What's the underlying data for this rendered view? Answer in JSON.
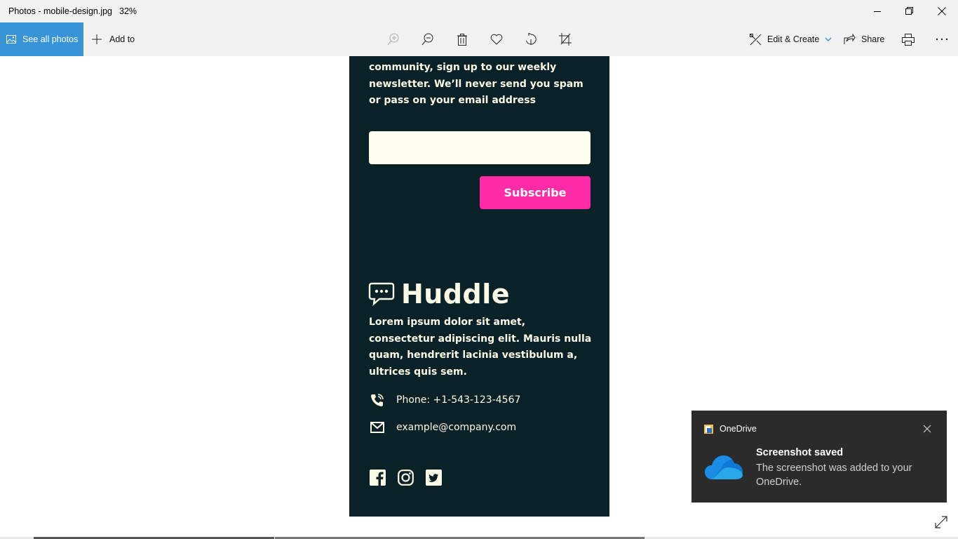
{
  "window": {
    "title": "Photos - mobile-design.jpg",
    "zoom": "32%"
  },
  "toolbar": {
    "see_all_label": "See all photos",
    "add_to_label": "Add to",
    "edit_create_label": "Edit & Create",
    "share_label": "Share",
    "accent_color": "#3794d6"
  },
  "photo": {
    "intro_text": "community, sign up to our weekly newsletter. We’ll never send you spam or pass on your email address",
    "email_placeholder": "",
    "subscribe_label": "Subscribe",
    "logo_text": "Huddle",
    "description": "Lorem ipsum dolor sit amet, consectetur adipiscing elit. Mauris nulla quam, hendrerit lacinia vestibulum a, ultrices quis sem.",
    "phone": "Phone: +1-543-123-4567",
    "email": "example@company.com",
    "social_icons": [
      "facebook-icon",
      "instagram-icon",
      "twitter-icon"
    ],
    "bg_color": "#0b2128",
    "accent_color": "#ff2ba7"
  },
  "notification": {
    "app": "OneDrive",
    "title": "Screenshot saved",
    "body": "The screenshot was added to your OneDrive."
  }
}
